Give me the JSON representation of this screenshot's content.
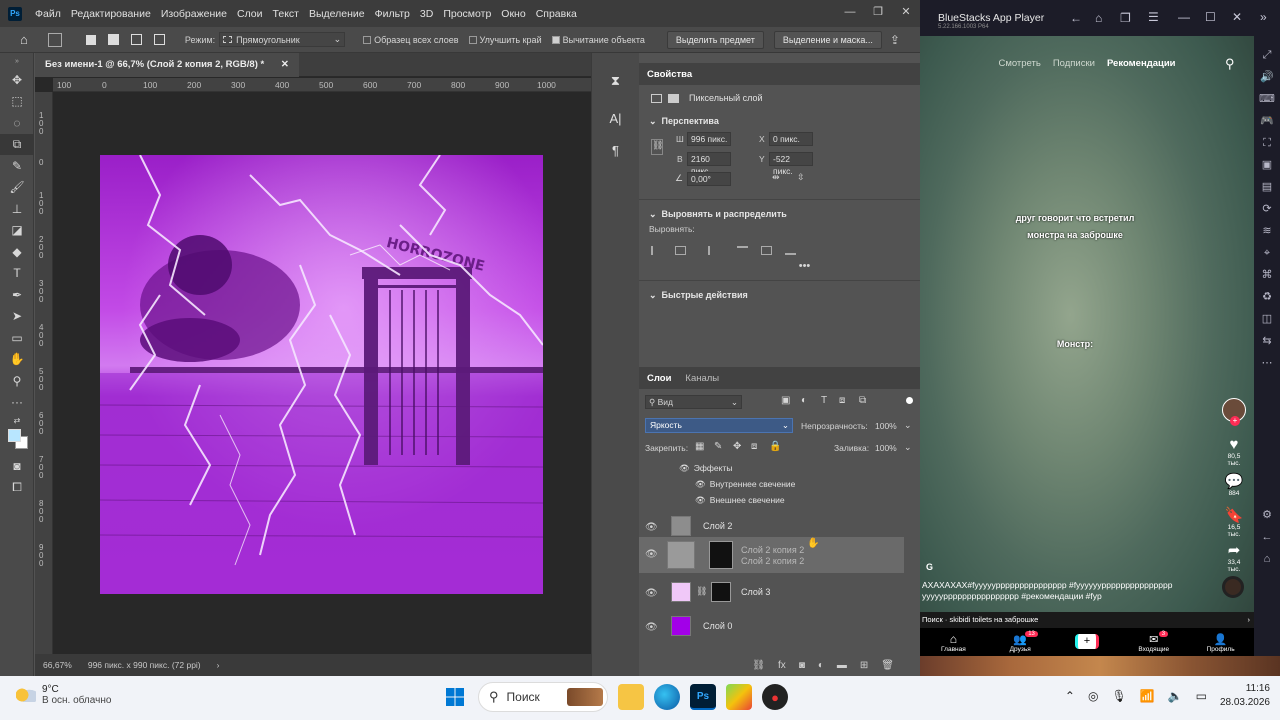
{
  "photoshop": {
    "menu": [
      "Файл",
      "Редактирование",
      "Изображение",
      "Слои",
      "Текст",
      "Выделение",
      "Фильтр",
      "3D",
      "Просмотр",
      "Окно",
      "Справка"
    ],
    "options": {
      "mode_label": "Режим:",
      "mode_value": "Прямоугольник",
      "sample_all": "Образец всех слоев",
      "enhance_edge": "Улучшить край",
      "object_subtract": "Вычитание объекта",
      "select_subject": "Выделить предмет",
      "select_mask": "Выделение и маска..."
    },
    "doc_tab": "Без имени-1 @ 66,7% (Слой 2 копия 2, RGB/8) *",
    "ruler_h": [
      "100",
      "0",
      "100",
      "200",
      "300",
      "400",
      "500",
      "600",
      "700",
      "800",
      "900",
      "1000"
    ],
    "ruler_v": [
      "1\n0\n0",
      "0",
      "1\n0\n0",
      "2\n0\n0",
      "3\n0\n0",
      "4\n0\n0",
      "5\n0\n0",
      "6\n0\n0",
      "7\n0\n0",
      "8\n0\n0",
      "9\n0\n0"
    ],
    "artwork_text": "HORROZONE",
    "status": {
      "zoom": "66,67%",
      "info": "996 пикс. x 990 пикс. (72 ppi)"
    },
    "properties": {
      "title": "Свойства",
      "kind": "Пиксельный слой",
      "transform_title": "Перспектива",
      "w_label": "Ш",
      "w_value": "996 пикс.",
      "h_label": "В",
      "h_value": "2160 пикс.",
      "x_label": "X",
      "x_value": "0 пикс.",
      "y_label": "Y",
      "y_value": "-522 пикс.",
      "angle_value": "0,00°",
      "align_title": "Выровнять и распределить",
      "align_label": "Выровнять:",
      "quick_title": "Быстрые действия"
    },
    "layers": {
      "tab_layers": "Слои",
      "tab_channels": "Каналы",
      "filter_value": "Вид",
      "blend_mode": "Яркость",
      "opacity_label": "Непрозрачность:",
      "opacity_value": "100%",
      "lock_label": "Закрепить:",
      "fill_label": "Заливка:",
      "fill_value": "100%",
      "effects_label": "Эффекты",
      "effect_inner": "Внутреннее свечение",
      "effect_outer": "Внешнее свечение",
      "layer_2": "Слой 2",
      "layer_2_copy2": "Слой 2 копия 2",
      "layer_3": "Слой 3",
      "layer_0": "Слой 0"
    }
  },
  "bluestacks": {
    "title": "BlueStacks App Player",
    "subtitle": "5.22.166.1003 P64",
    "tabs": [
      "Смотреть",
      "Подписки",
      "Рекомендации"
    ],
    "overlay1": "друг говорит что встретил\nмонстра на заброшке",
    "overlay2": "Монстр:",
    "likes": "80,5 тыс.",
    "comments": "884",
    "saves": "16,5 тыс.",
    "shares": "33,4 тыс.",
    "author_initial": "G",
    "caption": "АХАХАХАХ#fyyyyyppppppppppppppp #fyyyyyyppppppppppppppp yyyyypppppppppppppppp #рекомендации #fyp",
    "search_line": "Поиск · skibidi toilets на заброшке",
    "nav": [
      "Главная",
      "Друзья",
      "",
      "Входящие",
      "Профиль"
    ],
    "badge_friends": "13",
    "badge_inbox": "3"
  },
  "taskbar": {
    "temp": "9°C",
    "weather": "В осн. облачно",
    "search": "Поиск",
    "time": "11:16",
    "date": "28.03.2026"
  },
  "colors": {
    "ps_bg": "#535353",
    "accent_purple": "#b020d8",
    "layer0_fill": "#a200e8"
  }
}
